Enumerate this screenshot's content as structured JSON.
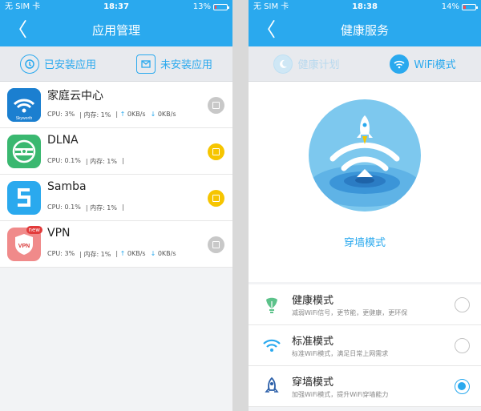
{
  "left": {
    "status": {
      "carrier": "无 SIM 卡",
      "time": "18:37",
      "battery": "13%",
      "battery_level": 0.13
    },
    "nav": {
      "back": "〈",
      "title": "应用管理"
    },
    "tabs": [
      {
        "label": "已安装应用",
        "icon": "installed-icon"
      },
      {
        "label": "未安装应用",
        "icon": "uninstalled-icon"
      }
    ],
    "apps": [
      {
        "name": "家庭云中心",
        "cpu": "CPU: 3%",
        "mem": "| 内存: 1%",
        "up": "0KB/s",
        "down": "0KB/s",
        "icon_text": "Skyworth",
        "check": "gray",
        "icon": "wifi-cloud-icon"
      },
      {
        "name": "DLNA",
        "cpu": "CPU: 0.1%",
        "mem": "| 内存: 1%",
        "up": "",
        "down": "",
        "icon_text": "",
        "check": "yellow",
        "icon": "dlna-icon"
      },
      {
        "name": "Samba",
        "cpu": "CPU: 0.1%",
        "mem": "| 内存: 1%",
        "up": "",
        "down": "",
        "icon_text": "",
        "check": "yellow",
        "icon": "samba-icon"
      },
      {
        "name": "VPN",
        "cpu": "CPU: 3%",
        "mem": "| 内存: 1%",
        "up": "0KB/s",
        "down": "0KB/s",
        "icon_text": "VPN",
        "badge": "new",
        "check": "gray",
        "icon": "vpn-shield-icon"
      }
    ]
  },
  "right": {
    "status": {
      "carrier": "无 SIM 卡",
      "time": "18:38",
      "battery": "14%",
      "battery_level": 0.14
    },
    "nav": {
      "back": "〈",
      "title": "健康服务"
    },
    "tabs": [
      {
        "label": "健康计划",
        "icon": "moon-icon"
      },
      {
        "label": "WiFi模式",
        "icon": "wifi-icon"
      }
    ],
    "hero": {
      "label": "穿墙模式",
      "icon": "rocket-wifi-icon"
    },
    "modes": [
      {
        "title": "健康模式",
        "desc": "减弱WiFi信号，更节能，更健康，更环保",
        "selected": false,
        "icon": "leaf-bulb-icon"
      },
      {
        "title": "标准模式",
        "desc": "标准WiFi模式，满足日常上网需求",
        "selected": false,
        "icon": "wifi-icon"
      },
      {
        "title": "穿墙模式",
        "desc": "加强WiFi模式，提升WiFi穿墙能力",
        "selected": true,
        "icon": "rocket-icon"
      }
    ]
  },
  "colors": {
    "primary": "#2aa9ee",
    "yellow": "#f6c500",
    "gray": "#c8c8c8"
  }
}
